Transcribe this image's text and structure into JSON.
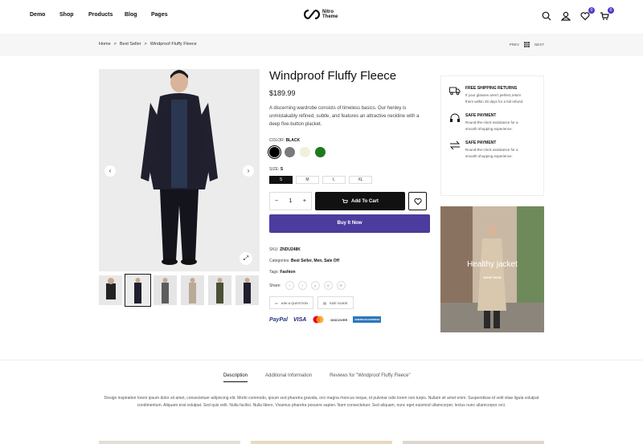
{
  "header": {
    "nav": [
      "Demo",
      "Shop",
      "Products",
      "Blog",
      "Pages"
    ],
    "logo_line1": "Nitro",
    "logo_line2": "Theme",
    "wishlist_count": "0",
    "cart_count": "0"
  },
  "breadcrumb": {
    "items": [
      "Home",
      "Best Seller",
      "Windproof Fluffy Fleece"
    ],
    "sep": ">",
    "prev": "PREV",
    "next": "NEXT"
  },
  "product": {
    "title": "Windproof Fluffy Fleece",
    "price": "$189.99",
    "description": "A discerning wardrobe consists of timeless basics. Our henley is unmistakably refined, subtle, and features an attractive neckline with a deep five-button placket.",
    "color_label": "COLOR:",
    "color_value": "BLACK",
    "colors": [
      "#000000",
      "#7a7a7a",
      "#f0f0dc",
      "#1f7a1f"
    ],
    "size_label": "SIZE:",
    "size_value": "S",
    "sizes": [
      "S",
      "M",
      "L",
      "XL"
    ],
    "qty": "1",
    "qty_minus": "−",
    "qty_plus": "+",
    "add_to_cart": "Add To Cart",
    "buy_now": "Buy It Now",
    "sku_label": "SKU:",
    "sku_value": "ZNDU248K",
    "categories_label": "Categories:",
    "categories_value": "Best Seller, Men, Sale Off",
    "tags_label": "Tags:",
    "tags_value": "Fashion",
    "share_label": "Share:",
    "ask_question": "ASK A QUESTION",
    "size_guide": "SIZE GUIDE",
    "payments": [
      "PayPal",
      "VISA",
      "DISCOVER",
      "AMERICAN EXPRESS"
    ]
  },
  "features": [
    {
      "title": "FREE SHIPPING RETURNS",
      "text": "If your glasses aren't perfect,return them within 30 days for a full refund."
    },
    {
      "title": "SAFE PAYMENT",
      "text": "Round-the-clock assistance for a smooth shopping experience."
    },
    {
      "title": "SAFE PAYMENT",
      "text": "Round-the-clock assistance for a smooth shopping experience."
    }
  ],
  "banner": {
    "title": "Healthy jacket",
    "link": "SHOP NOW"
  },
  "tabs": {
    "items": [
      "Description",
      "Additional Information",
      "Reviews for \"Windproof Fluffy Fleece\""
    ],
    "description": "Design inspiration lorem ipsum dolor sit amet, consectetuer adipiscing elit. Morbi commodo, ipsum sed pharetra gravida, orci magna rhoncus neque, id pulvinar odio lorem non turpis. Nullam sit amet enim. Suspendisse id velit vitae ligula volutpat condimentum. Aliquam erat volutpat. Sed quis velit. Nulla facilisi. Nulla libero. Vivamus pharetra posuere sapien. Nam consectetuer. Sed aliquam, nunc eget euismod ullamcorper, lectus nunc ullamcorper orci."
  },
  "colors": {
    "accent": "#4b3c9e",
    "dark": "#111111",
    "light_bg": "#f6f6f6"
  }
}
